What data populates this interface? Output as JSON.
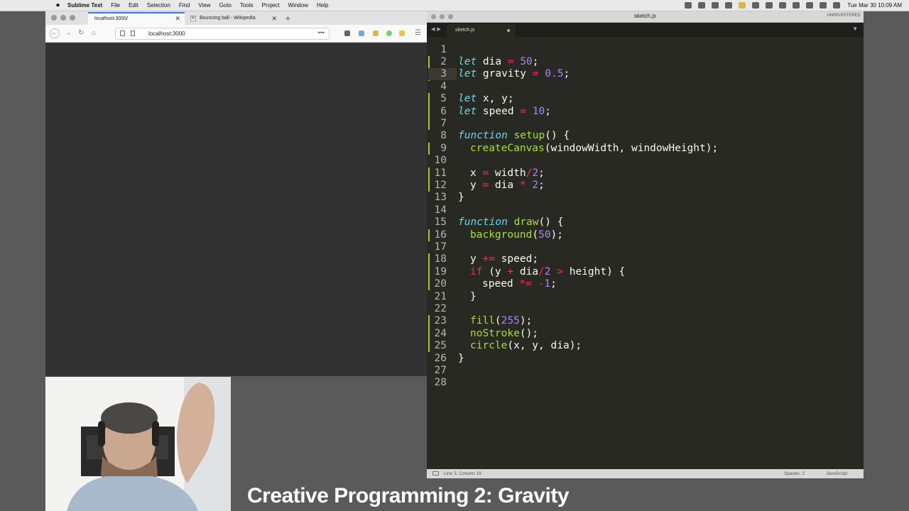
{
  "menubar": {
    "app_name": "Sublime Text",
    "items": [
      "File",
      "Edit",
      "Selection",
      "Find",
      "View",
      "Goto",
      "Tools",
      "Project",
      "Window",
      "Help"
    ],
    "clock": "Tue Mar 30  10:09 AM"
  },
  "browser": {
    "tabs": [
      {
        "label": "localhost:3000/"
      },
      {
        "label": "Bouncing ball - Wikipedia"
      }
    ],
    "new_tab": "+",
    "url": "localhost:3000",
    "more": "•••",
    "canvas_color": "#323232"
  },
  "editor": {
    "window_title": "sketch.js",
    "unregistered": "UNREGISTERED",
    "tab_name": "sketch.js",
    "status_position": "Line 3, Column 19",
    "status_spaces": "Spaces: 2",
    "status_language": "JavaScript",
    "line_numbers": [
      "1",
      "2",
      "3",
      "4",
      "5",
      "6",
      "7",
      "8",
      "9",
      "10",
      "11",
      "12",
      "13",
      "14",
      "15",
      "16",
      "17",
      "18",
      "19",
      "20",
      "21",
      "22",
      "23",
      "24",
      "25",
      "26",
      "27",
      "28"
    ],
    "code": [
      {
        "indent": 0,
        "tokens": []
      },
      {
        "indent": 0,
        "tokens": [
          [
            "kw",
            "let"
          ],
          [
            "t",
            " dia "
          ],
          [
            "op",
            "="
          ],
          [
            "t",
            " "
          ],
          [
            "num",
            "50"
          ],
          [
            "t",
            ";"
          ]
        ]
      },
      {
        "indent": 0,
        "tokens": [
          [
            "kw",
            "let"
          ],
          [
            "t",
            " gravity "
          ],
          [
            "op",
            "="
          ],
          [
            "t",
            " "
          ],
          [
            "num",
            "0.5"
          ],
          [
            "t",
            ";"
          ]
        ]
      },
      {
        "indent": 0,
        "tokens": []
      },
      {
        "indent": 0,
        "tokens": [
          [
            "kw",
            "let"
          ],
          [
            "t",
            " x, y;"
          ]
        ]
      },
      {
        "indent": 0,
        "tokens": [
          [
            "kw",
            "let"
          ],
          [
            "t",
            " speed "
          ],
          [
            "op",
            "="
          ],
          [
            "t",
            " "
          ],
          [
            "num",
            "10"
          ],
          [
            "t",
            ";"
          ]
        ]
      },
      {
        "indent": 0,
        "tokens": []
      },
      {
        "indent": 0,
        "tokens": [
          [
            "kw",
            "function"
          ],
          [
            "t",
            " "
          ],
          [
            "fn",
            "setup"
          ],
          [
            "t",
            "() {"
          ]
        ]
      },
      {
        "indent": 1,
        "tokens": [
          [
            "fn",
            "createCanvas"
          ],
          [
            "t",
            "(windowWidth, windowHeight);"
          ]
        ]
      },
      {
        "indent": 0,
        "tokens": []
      },
      {
        "indent": 1,
        "tokens": [
          [
            "t",
            "x "
          ],
          [
            "op",
            "="
          ],
          [
            "t",
            " width"
          ],
          [
            "op",
            "/"
          ],
          [
            "num",
            "2"
          ],
          [
            "t",
            ";"
          ]
        ]
      },
      {
        "indent": 1,
        "tokens": [
          [
            "t",
            "y "
          ],
          [
            "op",
            "="
          ],
          [
            "t",
            " dia "
          ],
          [
            "op",
            "*"
          ],
          [
            "t",
            " "
          ],
          [
            "num",
            "2"
          ],
          [
            "t",
            ";"
          ]
        ]
      },
      {
        "indent": 0,
        "tokens": [
          [
            "t",
            "}"
          ]
        ]
      },
      {
        "indent": 0,
        "tokens": []
      },
      {
        "indent": 0,
        "tokens": [
          [
            "kw",
            "function"
          ],
          [
            "t",
            " "
          ],
          [
            "fn",
            "draw"
          ],
          [
            "t",
            "() {"
          ]
        ]
      },
      {
        "indent": 1,
        "tokens": [
          [
            "fn",
            "background"
          ],
          [
            "t",
            "("
          ],
          [
            "num",
            "50"
          ],
          [
            "t",
            ");"
          ]
        ]
      },
      {
        "indent": 0,
        "tokens": []
      },
      {
        "indent": 1,
        "tokens": [
          [
            "t",
            "y "
          ],
          [
            "op",
            "+="
          ],
          [
            "t",
            " speed;"
          ]
        ]
      },
      {
        "indent": 1,
        "tokens": [
          [
            "op",
            "if"
          ],
          [
            "t",
            " (y "
          ],
          [
            "op",
            "+"
          ],
          [
            "t",
            " dia"
          ],
          [
            "op",
            "/"
          ],
          [
            "num",
            "2"
          ],
          [
            "t",
            " "
          ],
          [
            "op",
            ">"
          ],
          [
            "t",
            " height) {"
          ]
        ]
      },
      {
        "indent": 2,
        "tokens": [
          [
            "t",
            "speed "
          ],
          [
            "op",
            "*="
          ],
          [
            "t",
            " "
          ],
          [
            "op",
            "-"
          ],
          [
            "num",
            "1"
          ],
          [
            "t",
            ";"
          ]
        ]
      },
      {
        "indent": 1,
        "tokens": [
          [
            "t",
            "}"
          ]
        ]
      },
      {
        "indent": 0,
        "tokens": []
      },
      {
        "indent": 1,
        "tokens": [
          [
            "fn",
            "fill"
          ],
          [
            "t",
            "("
          ],
          [
            "num",
            "255"
          ],
          [
            "t",
            ");"
          ]
        ]
      },
      {
        "indent": 1,
        "tokens": [
          [
            "fn",
            "noStroke"
          ],
          [
            "t",
            "();"
          ]
        ]
      },
      {
        "indent": 1,
        "tokens": [
          [
            "fn",
            "circle"
          ],
          [
            "t",
            "(x, y, dia);"
          ]
        ]
      },
      {
        "indent": 0,
        "tokens": [
          [
            "t",
            "}"
          ]
        ]
      },
      {
        "indent": 0,
        "tokens": []
      },
      {
        "indent": 0,
        "tokens": []
      }
    ],
    "colors": {
      "keyword": "#66d9ef",
      "operator": "#f92672",
      "number": "#ae81ff",
      "function": "#a6e22e",
      "text": "#f8f8f2",
      "background": "#292923"
    }
  },
  "caption": "Creative Programming 2: Gravity"
}
